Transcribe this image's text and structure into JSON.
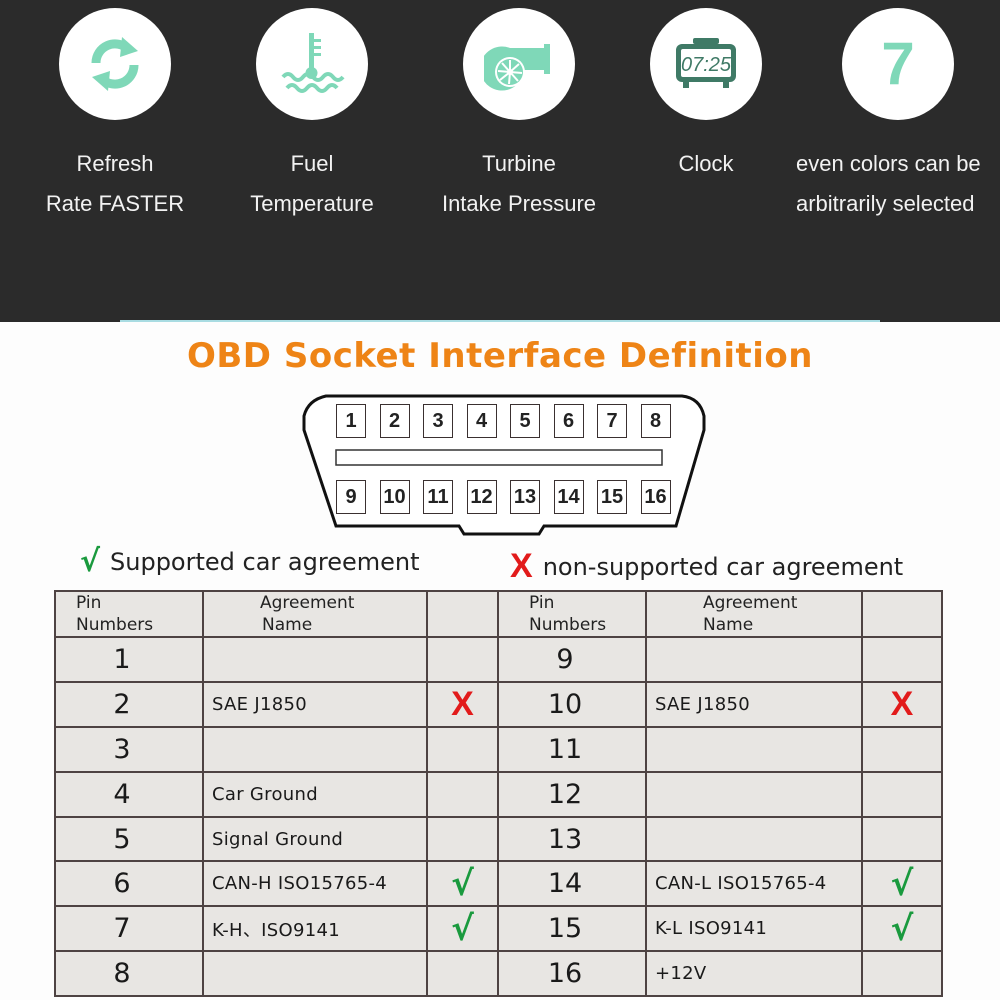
{
  "features": [
    {
      "icon": "refresh-icon",
      "line1": "Refresh",
      "line2": "Rate FASTER"
    },
    {
      "icon": "fuel-temperature-icon",
      "line1": "Fuel",
      "line2": "Temperature"
    },
    {
      "icon": "turbine-icon",
      "line1": "Turbine",
      "line2": "Intake Pressure"
    },
    {
      "icon": "clock-icon",
      "line1": "Clock",
      "line2": "",
      "clock_display": "07:25"
    },
    {
      "icon": "seven-icon",
      "glyph": "7",
      "line1": "even colors can be",
      "line2": "arbitrarily selected"
    }
  ],
  "colors": {
    "icon_mint": "#7fd8b8",
    "clock_green": "#3f7a66",
    "title_orange": "#ee8416",
    "check_green": "#1a9a3e",
    "cross_red": "#e21b1b"
  },
  "title": "OBD Socket Interface Definition",
  "connector": {
    "top_row": [
      "1",
      "2",
      "3",
      "4",
      "5",
      "6",
      "7",
      "8"
    ],
    "bottom_row": [
      "9",
      "10",
      "11",
      "12",
      "13",
      "14",
      "15",
      "16"
    ]
  },
  "legend": {
    "supported_symbol": "√",
    "supported_label": "Supported car agreement",
    "unsupported_symbol": "X",
    "unsupported_label": "non-supported car agreement"
  },
  "table": {
    "header": {
      "pin_line1": "Pin",
      "pin_line2": "Numbers",
      "name_line1": "Agreement",
      "name_line2": "Name"
    },
    "rows": [
      {
        "left": {
          "pin": "1",
          "name": "",
          "mark": ""
        },
        "right": {
          "pin": "9",
          "name": "",
          "mark": ""
        }
      },
      {
        "left": {
          "pin": "2",
          "name": "SAE  J1850",
          "mark": "X"
        },
        "right": {
          "pin": "10",
          "name": "SAE  J1850",
          "mark": "X"
        }
      },
      {
        "left": {
          "pin": "3",
          "name": "",
          "mark": ""
        },
        "right": {
          "pin": "11",
          "name": "",
          "mark": ""
        }
      },
      {
        "left": {
          "pin": "4",
          "name": "Car Ground",
          "mark": ""
        },
        "right": {
          "pin": "12",
          "name": "",
          "mark": ""
        }
      },
      {
        "left": {
          "pin": "5",
          "name": "Signal Ground",
          "mark": ""
        },
        "right": {
          "pin": "13",
          "name": "",
          "mark": ""
        }
      },
      {
        "left": {
          "pin": "6",
          "name": "CAN-H ISO15765-4",
          "mark": "√"
        },
        "right": {
          "pin": "14",
          "name": "CAN-L ISO15765-4",
          "mark": "√"
        }
      },
      {
        "left": {
          "pin": "7",
          "name": "K-H、ISO9141",
          "mark": "√"
        },
        "right": {
          "pin": "15",
          "name": "K-L ISO9141",
          "mark": "√"
        }
      },
      {
        "left": {
          "pin": "8",
          "name": "",
          "mark": ""
        },
        "right": {
          "pin": "16",
          "name": "+12V",
          "mark": ""
        }
      }
    ]
  }
}
